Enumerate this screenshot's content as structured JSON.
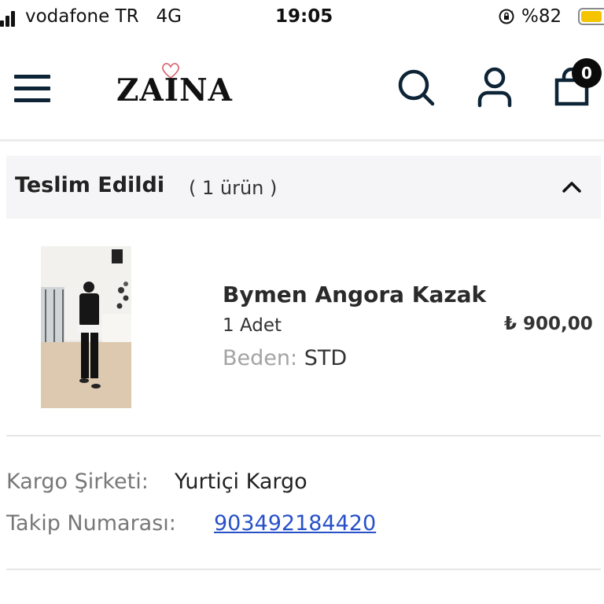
{
  "status_bar": {
    "carrier": "vodafone TR   4G",
    "time": "19:05",
    "battery_percent": "%82",
    "battery_level": 0.82
  },
  "header": {
    "logo_text": "ZAINA",
    "cart_count": "0",
    "icons": [
      "menu-icon",
      "search-icon",
      "user-icon",
      "cart-icon"
    ]
  },
  "order_section": {
    "status": "Teslim Edildi",
    "item_count": "( 1 ürün )",
    "product": {
      "name": "Bymen Angora Kazak",
      "quantity": "1 Adet",
      "size_label": "Beden:",
      "size_value": "STD",
      "price": "₺ 900,00"
    }
  },
  "shipping": {
    "carrier_label": "Kargo Şirketi:",
    "carrier_value": "Yurtiçi Kargo",
    "tracking_label": "Takip Numarası:",
    "tracking_value": "903492184420"
  },
  "colors": {
    "navy_icon": "#0d2436",
    "link": "#2851c8",
    "battery": "#f5c400",
    "section_bg": "#f5f5f7"
  }
}
